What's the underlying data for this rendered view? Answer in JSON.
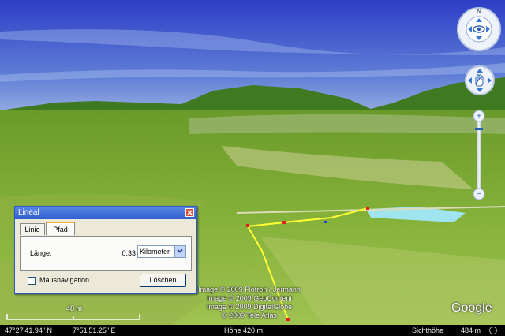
{
  "ruler": {
    "title": "Lineal",
    "tabs": [
      {
        "label": "Linie",
        "active": false
      },
      {
        "label": "Pfad",
        "active": true
      }
    ],
    "length_label": "Länge:",
    "length_value": "0.33",
    "unit": "Kilometer",
    "mouse_nav_label": "Mausnavigation",
    "mouse_nav_checked": false,
    "delete_label": "Löschen"
  },
  "scale": {
    "label": "48 m"
  },
  "attribution": [
    "Image © 2009 Flotron / Jermann",
    "Image © 2009 GeoContent",
    "Image © 2009 DigitalGlobe",
    "© 2009 Tele Atlas"
  ],
  "logo": "Google",
  "statusbar": {
    "latitude": "47°27'41.94\" N",
    "longitude": "7°51'51.25\" E",
    "elevation": "Höhe  420 m",
    "eye_alt_label": "Sichthöhe",
    "eye_alt_value": "484 m"
  },
  "colors": {
    "sky_top": "#2f3fc4",
    "sky_bottom": "#8aa6e2",
    "terrain": "#7aaa2c",
    "path": "#ffff33",
    "nav_accent": "#3b79d0"
  }
}
